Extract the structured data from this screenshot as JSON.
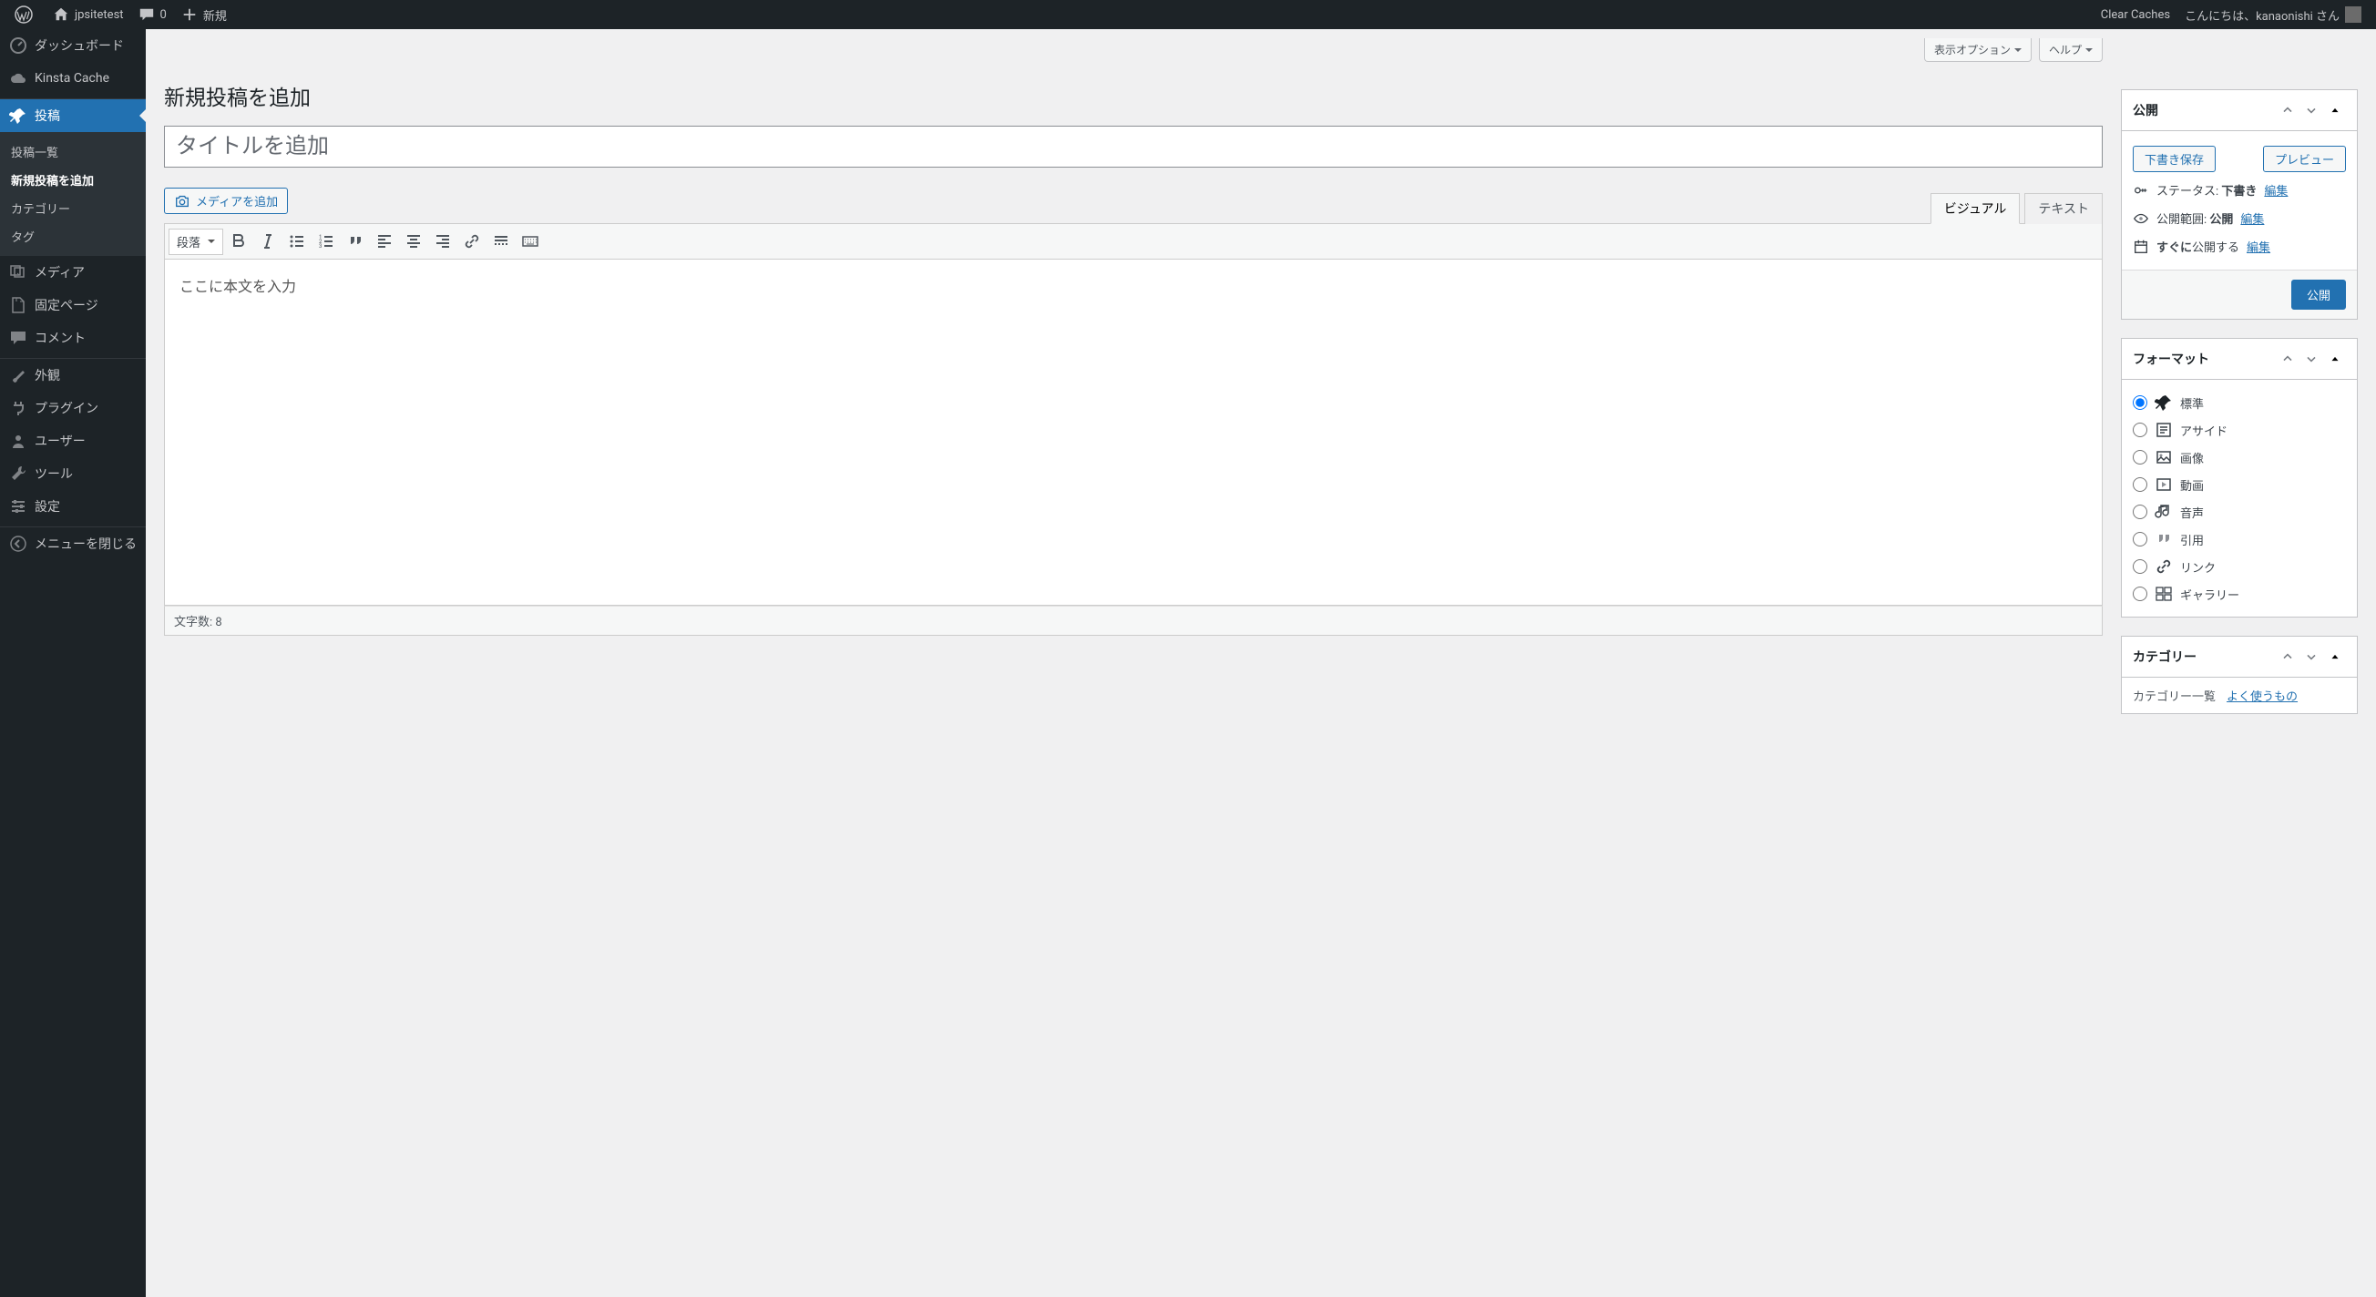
{
  "adminbar": {
    "site_name": "jpsitetest",
    "comments_count": "0",
    "new_label": "新規",
    "clear_caches": "Clear Caches",
    "greeting": "こんにちは、kanaonishi さん"
  },
  "sidebar": {
    "items": [
      {
        "label": "ダッシュボード",
        "icon": "dashboard"
      },
      {
        "label": "Kinsta Cache",
        "icon": "cloud"
      },
      {
        "label": "投稿",
        "icon": "pin",
        "current": true
      },
      {
        "label": "メディア",
        "icon": "media"
      },
      {
        "label": "固定ページ",
        "icon": "page"
      },
      {
        "label": "コメント",
        "icon": "comment"
      },
      {
        "label": "外観",
        "icon": "appearance"
      },
      {
        "label": "プラグイン",
        "icon": "plugin"
      },
      {
        "label": "ユーザー",
        "icon": "user"
      },
      {
        "label": "ツール",
        "icon": "tool"
      },
      {
        "label": "設定",
        "icon": "settings"
      },
      {
        "label": "メニューを閉じる",
        "icon": "collapse"
      }
    ],
    "submenu": [
      {
        "label": "投稿一覧"
      },
      {
        "label": "新規投稿を追加",
        "current": true
      },
      {
        "label": "カテゴリー"
      },
      {
        "label": "タグ"
      }
    ]
  },
  "screen_options": {
    "display": "表示オプション",
    "help": "ヘルプ"
  },
  "page": {
    "title": "新規投稿を追加",
    "title_placeholder": "タイトルを追加",
    "add_media": "メディアを追加",
    "tab_visual": "ビジュアル",
    "tab_text": "テキスト",
    "format_select": "段落",
    "body_placeholder": "ここに本文を入力",
    "word_count_label": "文字数: ",
    "word_count": "8"
  },
  "publish": {
    "title": "公開",
    "save_draft": "下書き保存",
    "preview": "プレビュー",
    "status_label": "ステータス: ",
    "status_value": "下書き",
    "visibility_label": "公開範囲: ",
    "visibility_value": "公開",
    "schedule_prefix": "すぐに",
    "schedule_suffix": "公開する",
    "edit": "編集",
    "publish_btn": "公開"
  },
  "format": {
    "title": "フォーマット",
    "items": [
      {
        "label": "標準",
        "selected": true
      },
      {
        "label": "アサイド"
      },
      {
        "label": "画像"
      },
      {
        "label": "動画"
      },
      {
        "label": "音声"
      },
      {
        "label": "引用"
      },
      {
        "label": "リンク"
      },
      {
        "label": "ギャラリー"
      }
    ]
  },
  "category": {
    "title": "カテゴリー",
    "tab_all": "カテゴリー一覧",
    "tab_popular": "よく使うもの"
  }
}
